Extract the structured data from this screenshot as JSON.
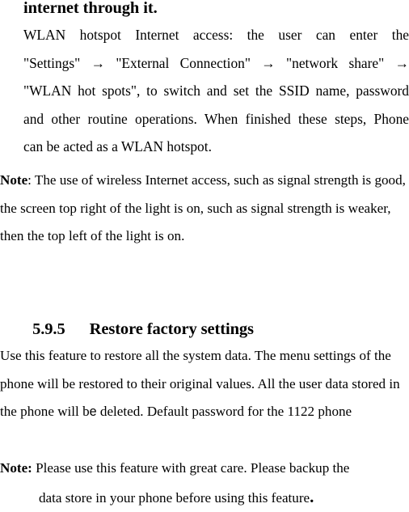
{
  "document": {
    "fragment_heading": "internet through it.",
    "hotspot_paragraph": {
      "line1": "WLAN  hotspot  Internet  access:  the  user  can  enter  the",
      "line2": "\"Settings\"  →  \"External  Connection\"  →  \"network  share\"  →",
      "line3": "\"WLAN hot spots\", to switch and set the SSID name, password",
      "line4": "and other routine operations. When finished these steps, Phone",
      "line5": "can be acted as a WLAN hotspot."
    },
    "note_paragraph": {
      "label": "Note",
      "separator": ": ",
      "text": "The use of wireless Internet access, such as signal strength is good, the screen top right of the light is on, such as signal strength is weaker, then the top left of the light is on."
    },
    "section_heading": {
      "number": "5.9.5",
      "title": "Restore factory settings"
    },
    "body_paragraph": {
      "part1": "Use this feature to restore all the system data. The menu settings of the phone will be restored to their original values. All the user data stored in the phone will b",
      "sans_glyph": "e",
      "part2": " deleted. Default password for the 1122 phone"
    },
    "final_note": {
      "label": "Note:",
      "line1_text": " Please use this feature with great care. Please backup the",
      "line2_text": "data store in your phone before using this feature",
      "line2_period": "."
    }
  }
}
